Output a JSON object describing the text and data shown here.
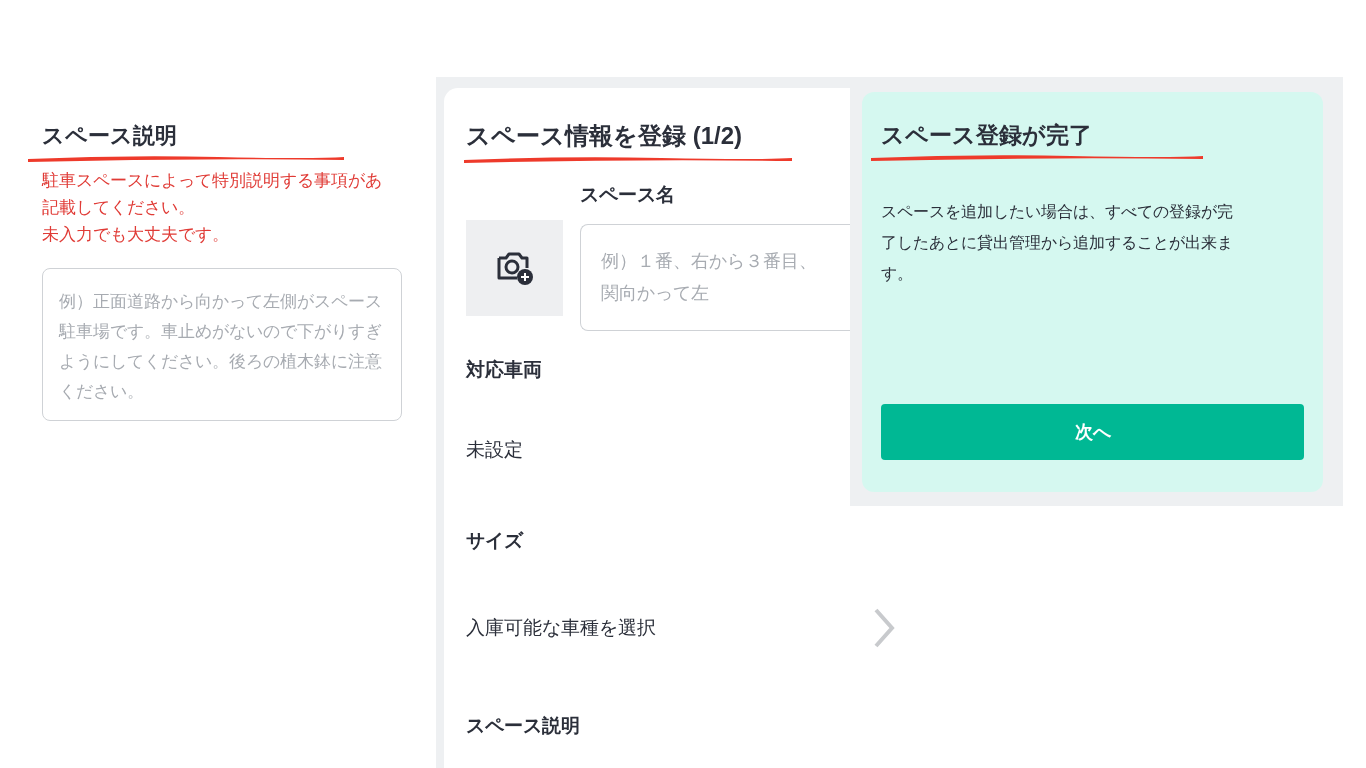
{
  "description_screen": {
    "title": "スペース説明",
    "note": [
      "駐車スペースによって特別説明する事項があ記載してください。",
      "未入力でも大丈夫です。"
    ],
    "description_field": {
      "placeholder": "例）正面道路から向かって左側がスペース駐車場です。車止めがないので下がりすぎようにしてください。後ろの植木鉢に注意ください。"
    }
  },
  "register_screen": {
    "title": "スペース情報を登録 (1/2)",
    "name_label": "スペース名",
    "name_field": {
      "placeholder": "例）１番、右から３番目、関向かって左"
    },
    "sections": [
      {
        "label": "対応車両",
        "value": "未設定",
        "kind": "text"
      },
      {
        "label": "サイズ",
        "value": "入庫可能な車種を選択",
        "kind": "select"
      },
      {
        "label": "スペース説明"
      }
    ]
  },
  "complete_screen": {
    "title": "スペース登録が完了",
    "message": "スペースを追加したい場合は、すべての登録が完了したあとに貸出管理から追加することが出来ます。",
    "next_button": "次へ"
  }
}
